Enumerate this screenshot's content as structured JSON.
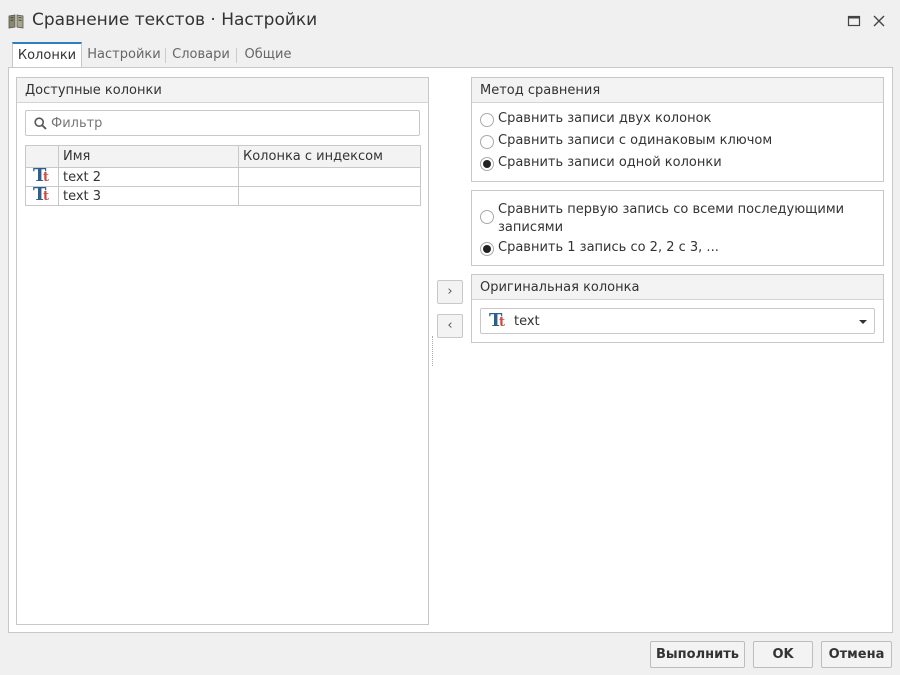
{
  "window": {
    "title": "Сравнение текстов · Настройки",
    "icon": "book-compare-icon"
  },
  "tabs": [
    {
      "label": "Колонки",
      "active": true
    },
    {
      "label": "Настройки",
      "active": false
    },
    {
      "label": "Словари",
      "active": false
    },
    {
      "label": "Общие",
      "active": false
    }
  ],
  "available_columns": {
    "header": "Доступные колонки",
    "filter_placeholder": "Фильтр",
    "table": {
      "headers": [
        "",
        "Имя",
        "Колонка с индексом"
      ],
      "rows": [
        {
          "type_icon": "text-type-icon",
          "name": "text 2",
          "index_column": ""
        },
        {
          "type_icon": "text-type-icon",
          "name": "text 3",
          "index_column": ""
        }
      ]
    }
  },
  "move_buttons": {
    "add": "›",
    "remove": "‹"
  },
  "comparison_method": {
    "header": "Метод сравнения",
    "options": [
      {
        "label": "Сравнить записи двух колонок",
        "checked": false
      },
      {
        "label": "Сравнить записи с одинаковым ключом",
        "checked": false
      },
      {
        "label": "Сравнить записи одной колонки",
        "checked": true
      }
    ]
  },
  "record_mode": {
    "options": [
      {
        "label": "Сравнить первую запись со всеми последующими записями",
        "checked": false
      },
      {
        "label": "Сравнить 1 запись со 2, 2 с 3, ...",
        "checked": true
      }
    ]
  },
  "original_column": {
    "header": "Оригинальная колонка",
    "value": "text"
  },
  "footer": {
    "run": "Выполнить",
    "ok": "OK",
    "cancel": "Отмена"
  }
}
